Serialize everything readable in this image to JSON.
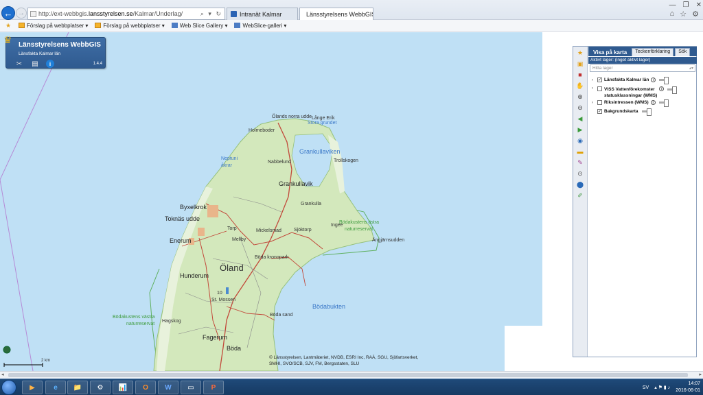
{
  "browser": {
    "address": {
      "prefix": "http://ext-webbgis.",
      "host": "lansstyrelsen.se",
      "path": "/Kalmar/Underlag/",
      "tools": "⌕ ▾ ↻"
    },
    "tabs": [
      {
        "label": "Intranät Kalmar"
      },
      {
        "label": "Länsstyrelsens WebbGIS"
      }
    ],
    "window_controls": [
      "—",
      "❐",
      "✕"
    ]
  },
  "favorites": [
    {
      "label": "Förslag på webbplatser ▾",
      "icon": "star-icon"
    },
    {
      "label": "Förslag på webbplatser ▾",
      "icon": "webslice-icon"
    },
    {
      "label": "Web Slice Gallery ▾",
      "icon": "gallery-icon"
    },
    {
      "label": "WebSlice-galleri ▾",
      "icon": "gallery-icon"
    }
  ],
  "gis_header": {
    "title": "Länsstyrelsens WebbGIS",
    "subtitle": "Länsfakta Kalmar län",
    "version": "1.4.4"
  },
  "panel": {
    "tabs": [
      "Visa på karta",
      "Teckenförklaring",
      "Sök"
    ],
    "active_layer": "Aktivt lager: (inget aktivt lager)",
    "filter_placeholder": "Hitta lager",
    "layers": [
      {
        "label": "Länsfakta Kalmar län",
        "checked": true
      },
      {
        "label": "VISS Vattenförekomster",
        "label2": "statusklassningar (WMS)",
        "checked": false
      },
      {
        "label": "Riksintressen (WMS)",
        "checked": false
      },
      {
        "label": "Bakgrundskarta",
        "checked": true
      }
    ]
  },
  "map": {
    "labels": {
      "olands_norra_udde": "Ölands norra udde",
      "lange_erik": "Långe Erik",
      "stora_grundet": "Stora grundet",
      "holmeboder": "Holmeboder",
      "grankullaviken": "Grankullaviken",
      "neptuni_akrar": "Neptuni åkrar",
      "nabbelund": "Nabbelund",
      "trollskogen": "Trollskogen",
      "grankullavik": "Grankullavik",
      "byxelkrok": "Byxelkrok",
      "toknas_udde": "Toknäs udde",
      "grankulla": "Grankulla",
      "bodakustens_ostra": "Bödakustens östra",
      "naturreservat": "naturreservat",
      "torp": "Torp",
      "mellby": "Mellby",
      "mickelsmad": "Mickelsmad",
      "sjoktorp": "Sjöktorp",
      "ingee": "Ingee",
      "enerum": "Enerum",
      "angjarnsudden": "Ängjärnsudden",
      "boda_kronopark": "Böda kronopark",
      "oland": "Öland",
      "hunderum": "Hunderum",
      "st_mossen": "St. Mossen",
      "bodabukten": "Bödabukten",
      "bodakustens_vastra": "Bödakustens västra",
      "naturreservat2": "naturreservat",
      "boda_sand": "Böda sand",
      "hagskog": "Hagskog",
      "fagerum": "Fagerum",
      "boda": "Böda",
      "road_10": "10"
    },
    "attribution_1": "© Länsstyrelsen, Lantmäteriet, NVDB, ESRI Inc, RAÄ, SGU, Sjöfartsverket,",
    "attribution_2": "SMHI, SVO/SCB, SJV, FM, Bergsstaten, SLU",
    "scale": "2 km",
    "colors": {
      "water": "#bfe0f5",
      "land": "#d3e8bc",
      "coast_light": "#e8f2dc",
      "road": "#c2483a"
    }
  },
  "taskbar": {
    "apps": [
      "e",
      "📁",
      "⚙",
      "📊",
      "O",
      "W",
      "▭",
      "P"
    ],
    "lang": "SV",
    "time": "14:07",
    "date": "2016-06-01"
  }
}
